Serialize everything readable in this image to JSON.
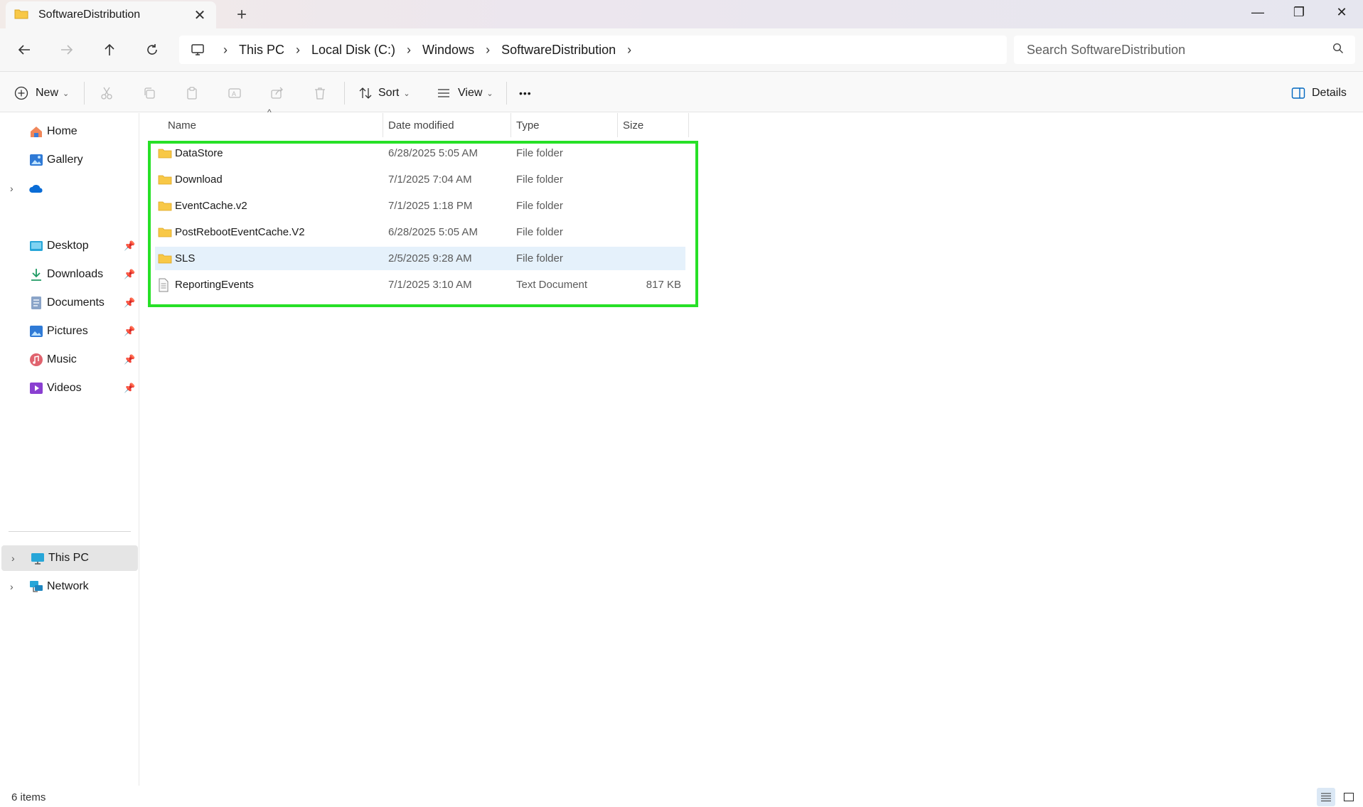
{
  "window": {
    "tab_title": "SoftwareDistribution",
    "tab_close": "✕",
    "new_tab": "+",
    "controls": {
      "minimize": "—",
      "restore": "❐",
      "close": "✕"
    }
  },
  "address": {
    "breadcrumbs": [
      "This PC",
      "Local Disk (C:)",
      "Windows",
      "SoftwareDistribution"
    ],
    "separator": "›",
    "search_placeholder": "Search SoftwareDistribution"
  },
  "toolbar": {
    "new_label": "New",
    "sort_label": "Sort",
    "view_label": "View",
    "more_label": "•••",
    "details_label": "Details"
  },
  "sidebar": {
    "top_items": [
      {
        "label": "Home",
        "icon": "home-icon"
      },
      {
        "label": "Gallery",
        "icon": "gallery-icon"
      },
      {
        "label": "",
        "icon": "onedrive-icon"
      }
    ],
    "pinned_items": [
      {
        "label": "Desktop",
        "icon": "desktop-icon"
      },
      {
        "label": "Downloads",
        "icon": "downloads-icon"
      },
      {
        "label": "Documents",
        "icon": "documents-icon"
      },
      {
        "label": "Pictures",
        "icon": "pictures-icon"
      },
      {
        "label": "Music",
        "icon": "music-icon"
      },
      {
        "label": "Videos",
        "icon": "videos-icon"
      }
    ],
    "bottom_items": [
      {
        "label": "This PC",
        "icon": "this-pc-icon",
        "selected": true
      },
      {
        "label": "Network",
        "icon": "network-icon"
      }
    ]
  },
  "file_list": {
    "columns": [
      "Name",
      "Date modified",
      "Type",
      "Size"
    ],
    "rows": [
      {
        "name": "DataStore",
        "date": "6/28/2025 5:05 AM",
        "type": "File folder",
        "size": "",
        "icon": "folder-icon"
      },
      {
        "name": "Download",
        "date": "7/1/2025 7:04 AM",
        "type": "File folder",
        "size": "",
        "icon": "folder-icon"
      },
      {
        "name": "EventCache.v2",
        "date": "7/1/2025 1:18 PM",
        "type": "File folder",
        "size": "",
        "icon": "folder-icon"
      },
      {
        "name": "PostRebootEventCache.V2",
        "date": "6/28/2025 5:05 AM",
        "type": "File folder",
        "size": "",
        "icon": "folder-icon"
      },
      {
        "name": "SLS",
        "date": "2/5/2025 9:28 AM",
        "type": "File folder",
        "size": "",
        "icon": "folder-icon",
        "hover": true
      },
      {
        "name": "ReportingEvents",
        "date": "7/1/2025 3:10 AM",
        "type": "Text Document",
        "size": "817 KB",
        "icon": "text-file-icon"
      }
    ]
  },
  "status": {
    "item_count": "6 items"
  },
  "colors": {
    "highlight": "#27e027",
    "folder": "#f8c847",
    "accent": "#0067c0"
  }
}
